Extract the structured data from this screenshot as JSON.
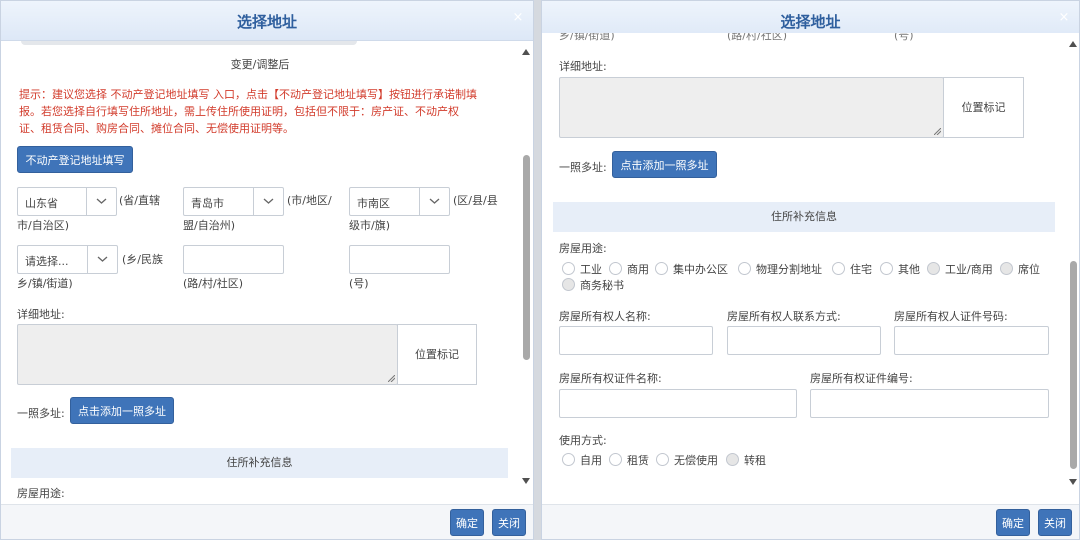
{
  "left": {
    "title": "选择地址",
    "close": "×",
    "change_label": "变更/调整后",
    "warning": [
      "提示：建议您选择 不动产登记地址填写 入口，点击【不动产登记地址填写】按钮进行承诺制填",
      "报。若您选择自行填写住所地址，需上传住所使用证明，包括但不限于：房产证、不动产权",
      "证、租赁合同、购房合同、摊位合同、无偿使用证明等。"
    ],
    "realestate_btn": "不动产登记地址填写",
    "province": {
      "value": "山东省",
      "suffix1": "(省/直辖",
      "suffix2": "市/自治区)"
    },
    "city": {
      "value": "青岛市",
      "suffix1": "(市/地区/",
      "suffix2": "盟/自治州)"
    },
    "district": {
      "value": "市南区",
      "suffix1": "(区/县/县",
      "suffix2": "级市/旗)"
    },
    "street": {
      "value": "请选择...",
      "suffix1": "(乡/民族",
      "suffix2": "乡/镇/街道)"
    },
    "road_label": "(路/村/社区)",
    "number_label": "(号)",
    "detail_label": "详细地址:",
    "position_btn": "位置标记",
    "multi_label": "一照多址:",
    "multi_btn": "点击添加一照多址",
    "section_title": "住所补充信息",
    "cut_text": "房屋用途:",
    "ok": "确定",
    "close_btn": "关闭"
  },
  "right": {
    "title": "选择地址",
    "close": "×",
    "top_cut": [
      "乡/镇/街道)",
      "(路/村/社区)",
      "(号)"
    ],
    "detail_label": "详细地址:",
    "position_btn": "位置标记",
    "multi_label": "一照多址:",
    "multi_btn": "点击添加一照多址",
    "section_title": "住所补充信息",
    "usage_label": "房屋用途:",
    "usage_options": [
      "工业",
      "商用",
      "集中办公区",
      "物理分割地址",
      "住宅",
      "其他",
      "工业/商用",
      "席位",
      "商务秘书"
    ],
    "owner_name": "房屋所有权人名称:",
    "owner_contact": "房屋所有权人联系方式:",
    "owner_id": "房屋所有权人证件号码:",
    "cert_name": "房屋所有权证件名称:",
    "cert_no": "房屋所有权证件编号:",
    "use_mode_label": "使用方式:",
    "use_modes": [
      "自用",
      "租赁",
      "无偿使用",
      "转租"
    ],
    "ok": "确定",
    "close_btn": "关闭"
  }
}
